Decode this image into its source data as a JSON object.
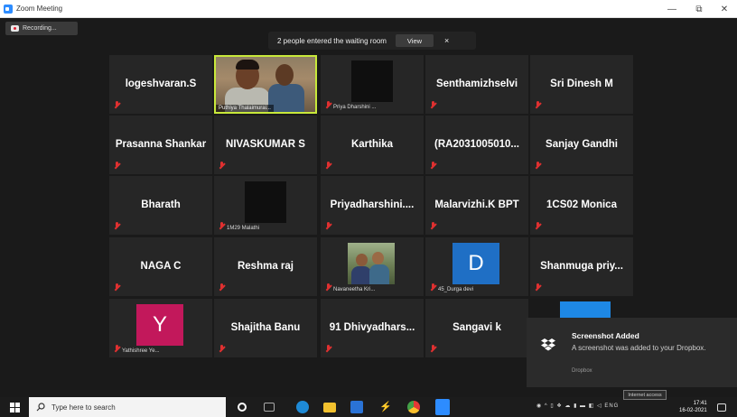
{
  "window": {
    "title": "Zoom Meeting",
    "minimize": "—",
    "maximize": "⧉",
    "close": "✕"
  },
  "recording": {
    "label": "Recording..."
  },
  "waiting_room": {
    "message": "2 people entered the waiting room",
    "view_label": "View",
    "close_label": "×"
  },
  "tiles": [
    {
      "name": "logeshvaran.S"
    },
    {
      "caption": "Puthiya Thalaimurai..."
    },
    {
      "caption": "Priya Dharshini ..."
    },
    {
      "name": "Senthamizhselvi"
    },
    {
      "name": "Sri Dinesh M"
    },
    {
      "name": "Prasanna Shankar"
    },
    {
      "name": "NIVASKUMAR S"
    },
    {
      "name": "Karthika"
    },
    {
      "name": "(RA2031005010..."
    },
    {
      "name": "Sanjay Gandhi"
    },
    {
      "name": "Bharath"
    },
    {
      "caption": "1M29 Malathi"
    },
    {
      "name": "Priyadharshini...."
    },
    {
      "name": "Malarvizhi.K BPT"
    },
    {
      "name": "1CS02 Monica"
    },
    {
      "name": "NAGA C"
    },
    {
      "name": "Reshma raj"
    },
    {
      "caption": "Navaneetha Kri..."
    },
    {
      "letter": "D",
      "caption": "45_Durga devi",
      "color": "#1f6fc5"
    },
    {
      "name": "Shanmuga  priy..."
    },
    {
      "letter": "Y",
      "caption": "Yathishree Ye...",
      "color": "#c2185b"
    },
    {
      "name": "Shajitha Banu"
    },
    {
      "name": "91  Dhivyadhars..."
    },
    {
      "name": "Sangavi k"
    }
  ],
  "toast": {
    "title": "Screenshot Added",
    "message": "A screenshot was added to your Dropbox.",
    "source": "Dropbox",
    "accent": "#1e88e5"
  },
  "taskbar": {
    "search_placeholder": "Type here to search",
    "tooltip": "Internet access",
    "tray": "ENG",
    "time": "17:41",
    "date": "16-02-2021"
  }
}
